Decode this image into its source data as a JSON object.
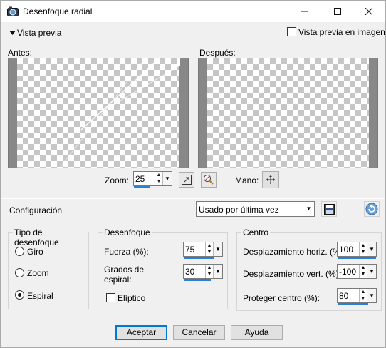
{
  "window": {
    "title": "Desenfoque radial",
    "minimize_icon": "minimize-icon",
    "maximize_icon": "maximize-icon",
    "close_icon": "close-icon"
  },
  "preview": {
    "toggle_label": "Vista previa",
    "in_image_label": "Vista previa en imagen",
    "in_image_checked": false,
    "before_label": "Antes:",
    "after_label": "Después:",
    "zoom_label": "Zoom:",
    "zoom_value": "25",
    "pan_label": "Mano:"
  },
  "config": {
    "label": "Configuración",
    "preset_value": "Usado por última vez"
  },
  "blur_type": {
    "title": "Tipo de desenfoque",
    "options": [
      "Giro",
      "Zoom",
      "Espiral"
    ],
    "selected": "Espiral"
  },
  "blur": {
    "title": "Desenfoque",
    "strength_label": "Fuerza (%):",
    "strength_value": "75",
    "spiral_label": "Grados de espiral:",
    "spiral_value": "30",
    "elliptic_label": "Elíptico",
    "elliptic_checked": false
  },
  "center": {
    "title": "Centro",
    "h_offset_label": "Desplazamiento horiz. (%):",
    "h_offset_value": "100",
    "v_offset_label": "Desplazamiento vert. (%):",
    "v_offset_value": "-100",
    "protect_label": "Proteger centro (%):",
    "protect_value": "80"
  },
  "buttons": {
    "ok": "Aceptar",
    "cancel": "Cancelar",
    "help": "Ayuda"
  },
  "colors": {
    "accent": "#2a7fd6",
    "default_button_border": "#0078d7"
  }
}
